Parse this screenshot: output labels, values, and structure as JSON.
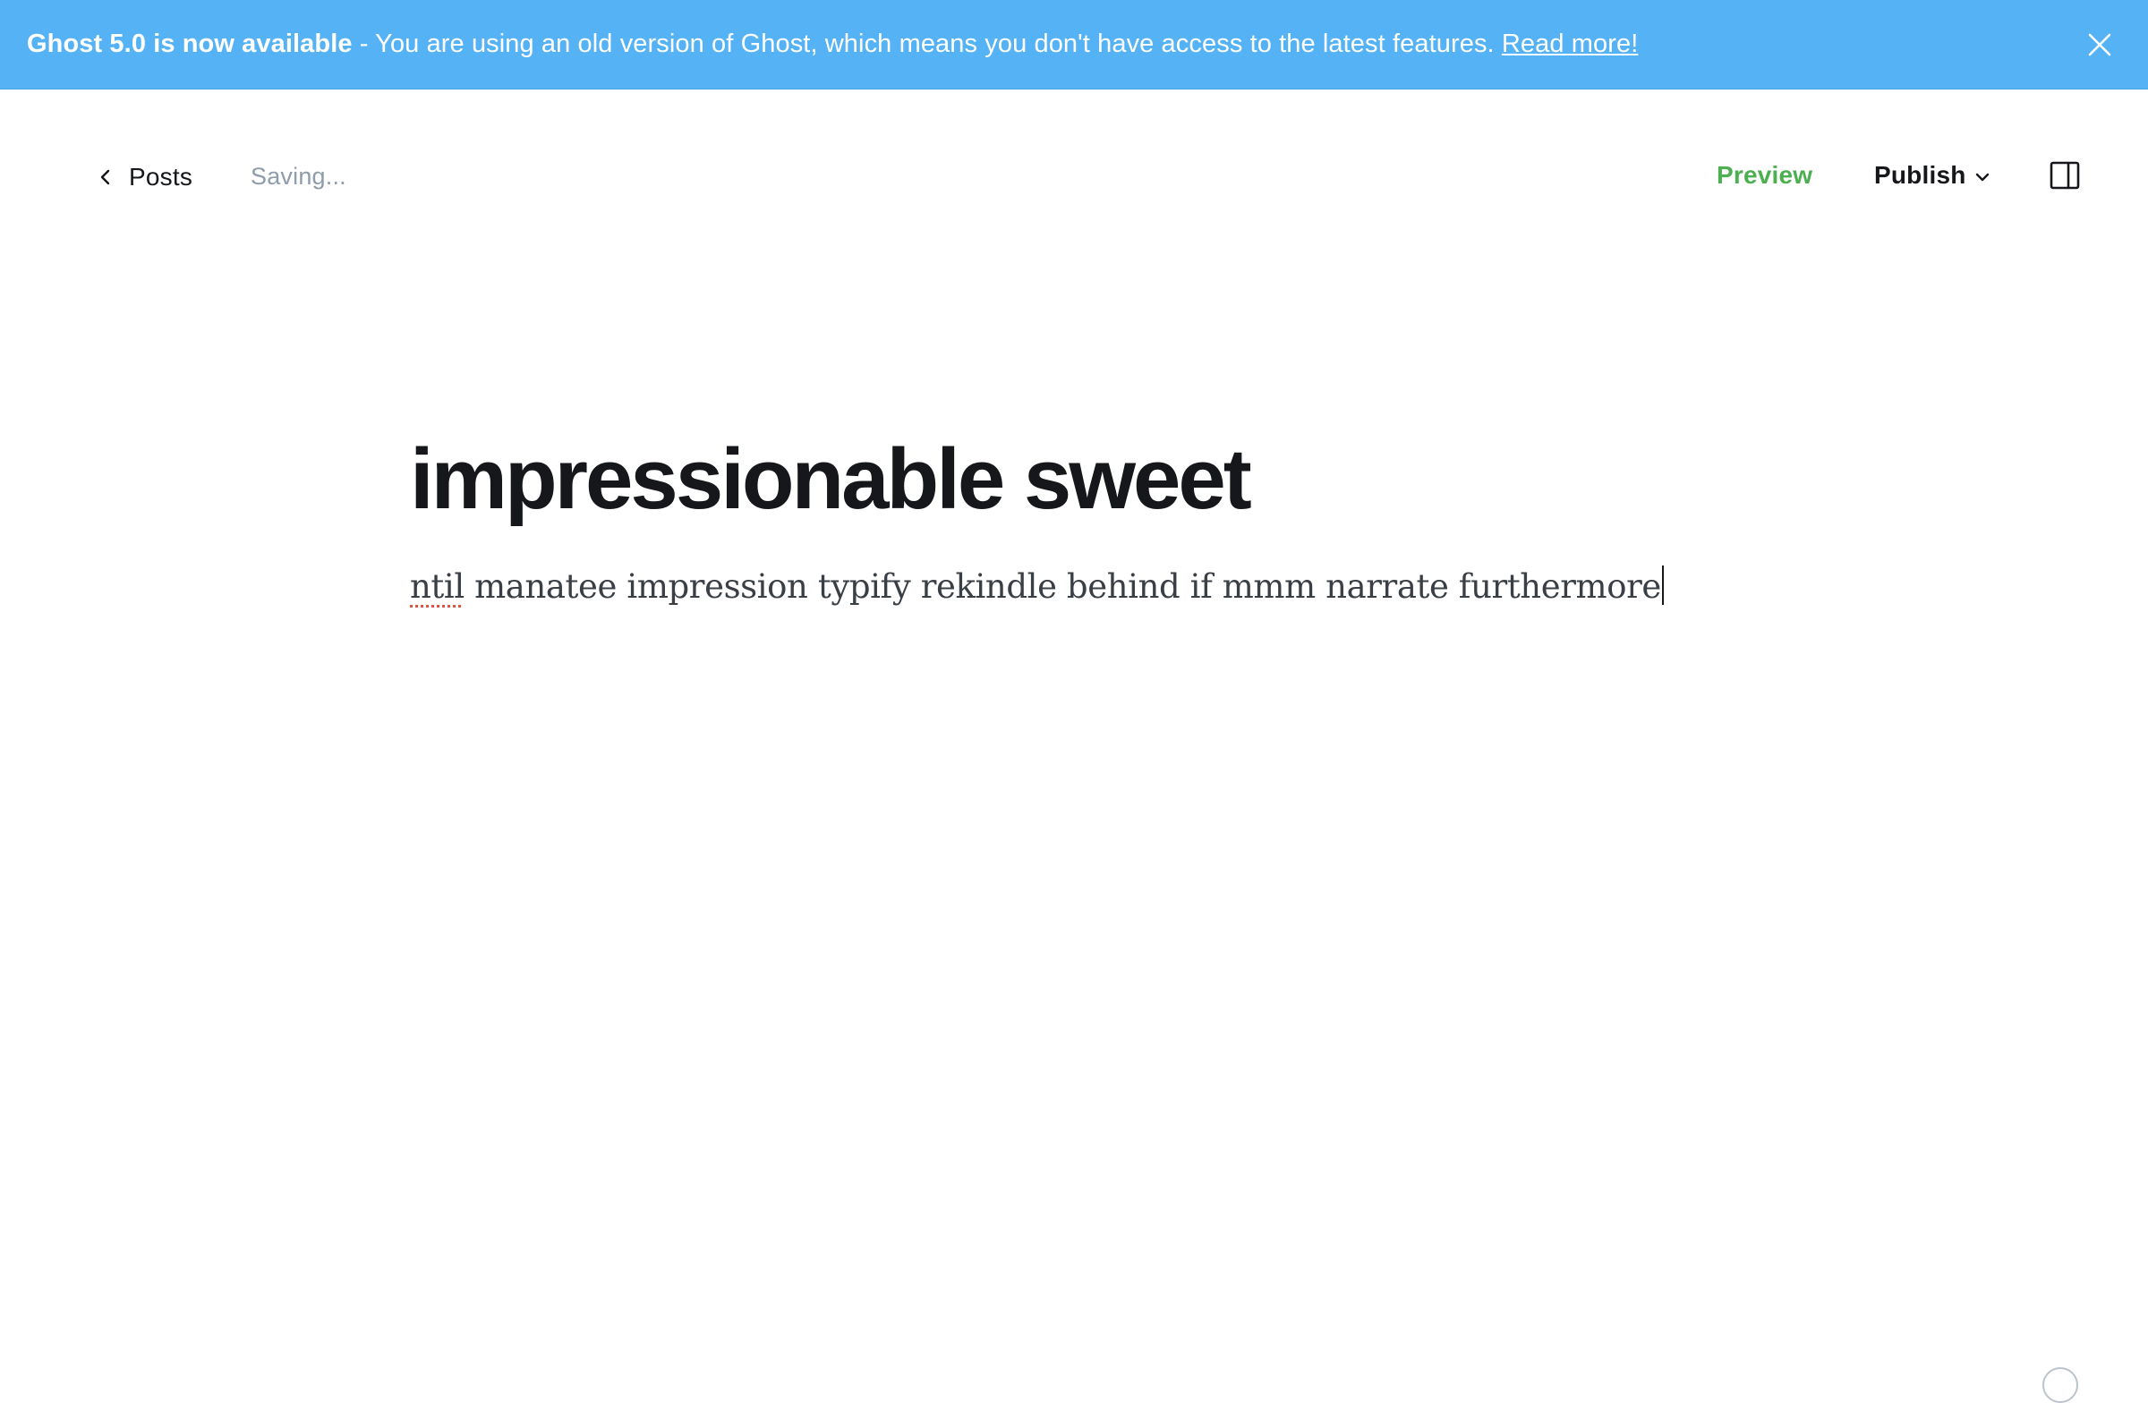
{
  "banner": {
    "headline": "Ghost 5.0 is now available",
    "message": " - You are using an old version of Ghost, which means you don't have access to the latest features. ",
    "link_text": "Read more!",
    "background": "#55b3f5"
  },
  "header": {
    "back_label": "Posts",
    "save_status": "Saving...",
    "preview_label": "Preview",
    "publish_label": "Publish",
    "preview_color": "#4caf50"
  },
  "post": {
    "title": "impressionable sweet",
    "body_first_word": "ntil",
    "body_rest": " manatee impression typify rekindle behind if mmm narrate furthermore"
  },
  "icons": {
    "banner_close": "close-icon",
    "back": "chevron-left-icon",
    "publish_menu": "chevron-down-icon",
    "sidebar": "sidebar-toggle-icon",
    "help": "help-icon"
  }
}
